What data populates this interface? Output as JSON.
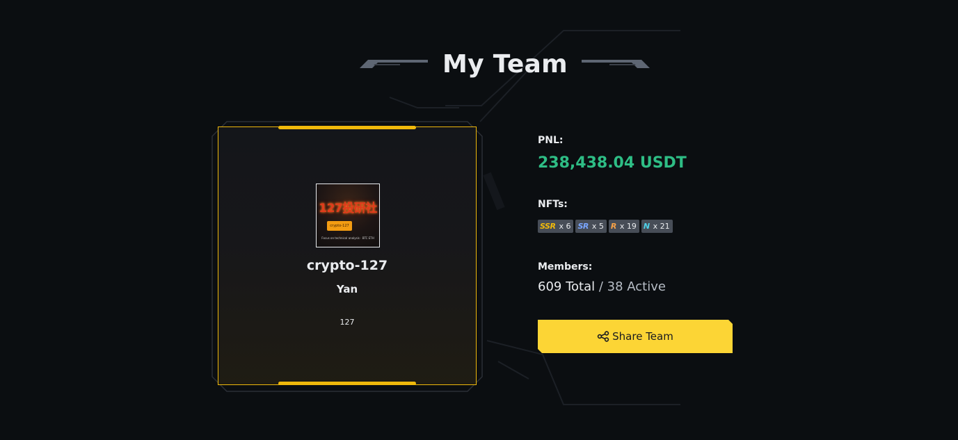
{
  "header": {
    "title": "My Team"
  },
  "team_card": {
    "avatar": {
      "title_text": "127投研社",
      "pill_text": "crypto-127 CN",
      "caption_text": "Focus on technical analysis · BTC ETH"
    },
    "team_name": "crypto-127",
    "leader_name": "Yan",
    "description": "127"
  },
  "stats": {
    "pnl_label": "PNL:",
    "pnl_value": "238,438.04 USDT",
    "nfts_label": "NFTs:",
    "nfts": [
      {
        "tier": "SSR",
        "count": "x 6",
        "color": "#f0b90b"
      },
      {
        "tier": "SR",
        "count": "x 5",
        "color": "#7aa6ff"
      },
      {
        "tier": "R",
        "count": "x 19",
        "color": "#f7a247"
      },
      {
        "tier": "N",
        "count": "x 21",
        "color": "#4fd1e8"
      }
    ],
    "members_label": "Members:",
    "members_total": "609 Total",
    "members_separator": " / ",
    "members_active": "38 Active"
  },
  "actions": {
    "share_label": "Share Team",
    "share_icon": "share-icon"
  },
  "colors": {
    "background": "#0b0e11",
    "accent": "#f0b90b",
    "button": "#fcd535",
    "positive": "#2ebd85"
  }
}
